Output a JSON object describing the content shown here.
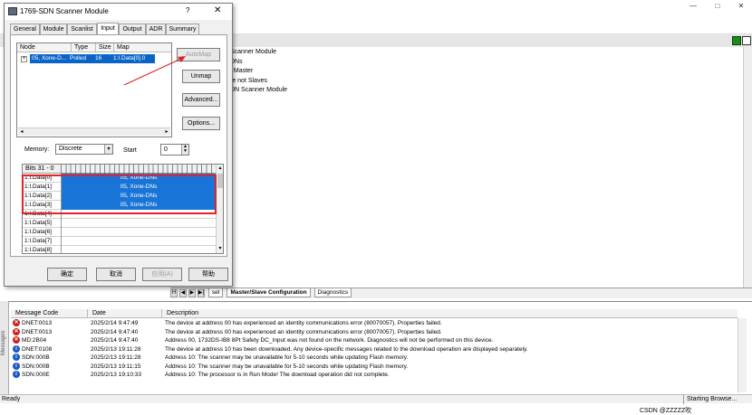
{
  "background_window": {
    "tree_lines": [
      "Scanner Module",
      "DNs",
      "t Master",
      "re not Slaves",
      "DN Scanner Module"
    ],
    "minimize_icon": "minimize-icon",
    "maximize_icon": "maximize-icon",
    "close_icon": "close-icon",
    "bottom_tabs": {
      "first": "H",
      "partial_sheet": "set",
      "active": "Master/Slave Configuration",
      "other": "Diagnostics"
    }
  },
  "dialog": {
    "title": "1769-SDN Scanner Module",
    "help": "?",
    "close": "✕",
    "tabs": [
      "General",
      "Module",
      "Scanlist",
      "Input",
      "Output",
      "ADR",
      "Summary"
    ],
    "active_tab": "Input",
    "node_list": {
      "headers": [
        "Node",
        "Type",
        "Size",
        "Map"
      ],
      "row": {
        "node": "05, Xone-D...",
        "type": "Polled",
        "size": "16",
        "map": "1:I.Data[0].0"
      }
    },
    "buttons": {
      "automap": "AutoMap",
      "unmap": "Unmap",
      "advanced": "Advanced...",
      "options": "Options..."
    },
    "memory_label": "Memory:",
    "memory_value": "Discrete",
    "start_label": "Start",
    "start_value": "0",
    "bits": {
      "header": "Bits 31 - 0",
      "rows": [
        {
          "label": "1:I.Data[0]",
          "value": "05, Xone-DNs"
        },
        {
          "label": "1:I.Data[1]",
          "value": "05, Xone-DNs"
        },
        {
          "label": "1:I.Data[2]",
          "value": "05, Xone-DNs"
        },
        {
          "label": "1:I.Data[3]",
          "value": "05, Xone-DNs"
        },
        {
          "label": "1:I.Data[4]",
          "value": ""
        },
        {
          "label": "1:I.Data[5]",
          "value": ""
        },
        {
          "label": "1:I.Data[6]",
          "value": ""
        },
        {
          "label": "1:I.Data[7]",
          "value": ""
        },
        {
          "label": "1:I.Data[8]",
          "value": ""
        }
      ]
    },
    "footer": {
      "ok": "确定",
      "cancel": "取消",
      "apply": "应用(A)",
      "help": "帮助"
    }
  },
  "messages": {
    "side_label": "Messages",
    "headers": [
      "Message Code",
      "Date",
      "Description"
    ],
    "rows": [
      {
        "icon": "error",
        "code": "DNET:0013",
        "date": "2025/2/14 9:47:49",
        "desc": "The device at address 00 has experienced an identity communications error (80070057). Properties failed."
      },
      {
        "icon": "error",
        "code": "DNET:0013",
        "date": "2025/2/14 9:47:40",
        "desc": "The device at address 00 has experienced an identity communications error (80070057). Properties failed."
      },
      {
        "icon": "error",
        "code": "MD:2B04",
        "date": "2025/2/14 9:47:40",
        "desc": "Address 00, 1732DS-IB8 8Pt Safety DC_Input was not found on the network. Diagnostics will not be performed on this device."
      },
      {
        "icon": "info",
        "code": "DNET:0108",
        "date": "2025/2/13 19:11:28",
        "desc": "The device at address 10 has been downloaded.  Any device-specific messages related to the download operation are displayed separately."
      },
      {
        "icon": "info",
        "code": "SDN:000B",
        "date": "2025/2/13 19:11:28",
        "desc": "Address 10: The scanner may be unavailable for 5-10 seconds while updating Flash memory."
      },
      {
        "icon": "info",
        "code": "SDN:000B",
        "date": "2025/2/13 19:11:15",
        "desc": "Address 10: The scanner may be unavailable for 5-10 seconds while updating Flash memory."
      },
      {
        "icon": "info",
        "code": "SDN:000E",
        "date": "2025/2/13 19:10:33",
        "desc": "Address 10: The processor is in Run Mode!  The download operation did not complete."
      }
    ]
  },
  "status": {
    "ready": "Ready",
    "browse": "Starting Browse..."
  },
  "watermark": "CSDN @ZZZZZ吹",
  "colors": {
    "selection": "#0a64c8",
    "mapped": "#1874d6",
    "highlight_box": "#e0242c",
    "error_icon": "#d21c1c",
    "info_icon": "#1a55c8"
  }
}
